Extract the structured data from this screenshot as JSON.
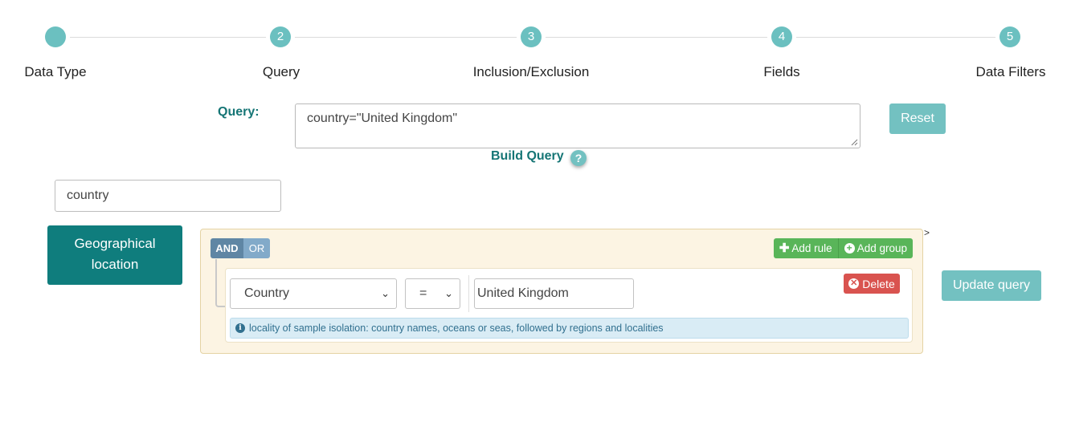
{
  "stepper": {
    "steps": [
      {
        "number": "",
        "label": "Data Type"
      },
      {
        "number": "2",
        "label": "Query"
      },
      {
        "number": "3",
        "label": "Inclusion/Exclusion"
      },
      {
        "number": "4",
        "label": "Fields"
      },
      {
        "number": "5",
        "label": "Data Filters"
      }
    ]
  },
  "query": {
    "label": "Query:",
    "value": "country=\"United Kingdom\"",
    "reset_label": "Reset",
    "build_label": "Build Query",
    "help_glyph": "?"
  },
  "field_search": {
    "value": "country"
  },
  "category": {
    "label_line1": "Geographical",
    "label_line2": "location"
  },
  "builder": {
    "and_label": "AND",
    "or_label": "OR",
    "add_rule_label": "Add rule",
    "add_group_label": "Add group",
    "rule": {
      "field": "Country",
      "operator": "=",
      "value": "United Kingdom",
      "delete_label": "Delete",
      "description": "locality of sample isolation: country names, oceans or seas, followed by regions and localities"
    }
  },
  "update_label": "Update query",
  "colors": {
    "teal": "#73c1c1",
    "dark_teal": "#0f7d7d",
    "green": "#59b559",
    "red": "#d9534f"
  }
}
